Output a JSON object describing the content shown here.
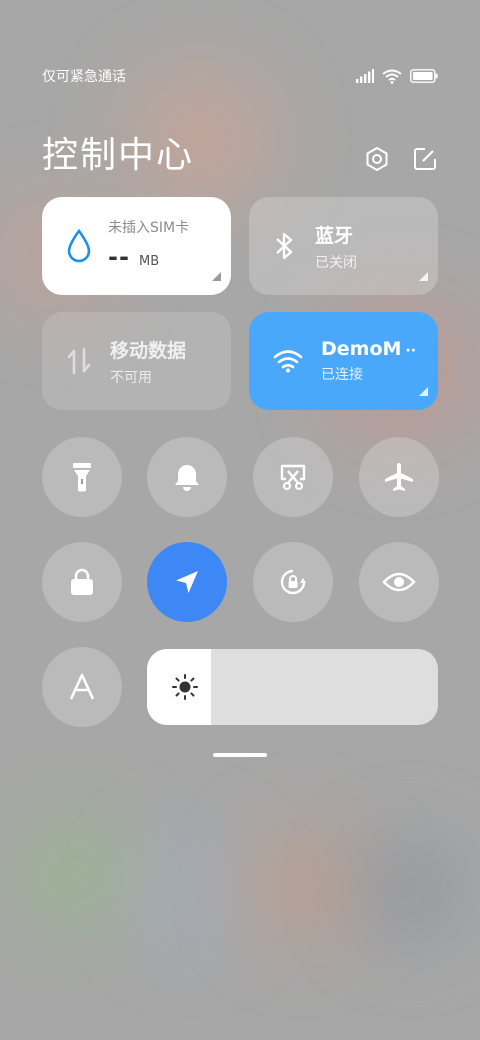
{
  "status_bar": {
    "carrier": "仅可紧急通话",
    "icons": [
      "signal-icon",
      "wifi-icon",
      "battery-icon"
    ]
  },
  "header": {
    "title": "控制中心",
    "settings_icon": "settings-icon",
    "edit_icon": "edit-icon"
  },
  "tiles": {
    "data": {
      "label": "未插入SIM卡",
      "value": "--",
      "unit": "MB",
      "icon": "drop-icon"
    },
    "bluetooth": {
      "label": "蓝牙",
      "status": "已关闭",
      "icon": "bluetooth-icon"
    },
    "mobile_data": {
      "label": "移动数据",
      "status": "不可用",
      "icon": "mobile-data-icon"
    },
    "wifi": {
      "label": "DemoM",
      "status": "已连接",
      "icon": "wifi-icon"
    }
  },
  "toggles": [
    {
      "name": "flashlight",
      "icon": "flashlight-icon",
      "active": false
    },
    {
      "name": "mute",
      "icon": "bell-icon",
      "active": false
    },
    {
      "name": "screenshot",
      "icon": "screenshot-icon",
      "active": false
    },
    {
      "name": "airplane",
      "icon": "airplane-icon",
      "active": false
    },
    {
      "name": "lock",
      "icon": "lock-icon",
      "active": false
    },
    {
      "name": "location",
      "icon": "location-icon",
      "active": true
    },
    {
      "name": "rotation-lock",
      "icon": "rotation-lock-icon",
      "active": false
    },
    {
      "name": "reading-mode",
      "icon": "eye-icon",
      "active": false
    },
    {
      "name": "auto-brightness",
      "icon": "font-a-icon",
      "active": false
    }
  ],
  "brightness": {
    "level": 0.22,
    "icon": "sun-icon"
  },
  "colors": {
    "active_blue": "#3d88f5",
    "wifi_tile": "#4aa8fb",
    "data_drop": "#1e90e8"
  }
}
